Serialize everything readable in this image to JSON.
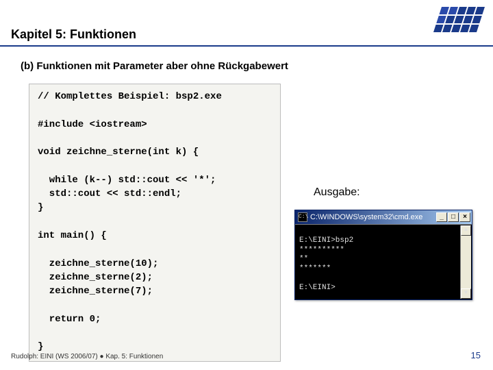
{
  "title": "Kapitel 5: Funktionen",
  "subhead": "(b) Funktionen mit Parameter aber ohne Rückgabewert",
  "code": "// Komplettes Beispiel: bsp2.exe\n\n#include <iostream>\n\nvoid zeichne_sterne(int k) {\n\n  while (k--) std::cout << '*';\n  std::cout << std::endl;\n}\n\nint main() {\n\n  zeichne_sterne(10);\n  zeichne_sterne(2);\n  zeichne_sterne(7);\n\n  return 0;\n\n}",
  "output_label": "Ausgabe:",
  "cmd": {
    "icon": "C:\\",
    "title": "C:\\WINDOWS\\system32\\cmd.exe",
    "buttons": {
      "min": "_",
      "max": "□",
      "close": "×"
    },
    "body": "\nE:\\EINI>bsp2\n**********\n**\n*******\n\nE:\\EINI>",
    "scroll": {
      "up": "▲",
      "down": "▼"
    }
  },
  "footer": {
    "left": "Rudolph: EINI (WS 2006/07)  ●  Kap. 5: Funktionen",
    "pagenum": "15"
  }
}
